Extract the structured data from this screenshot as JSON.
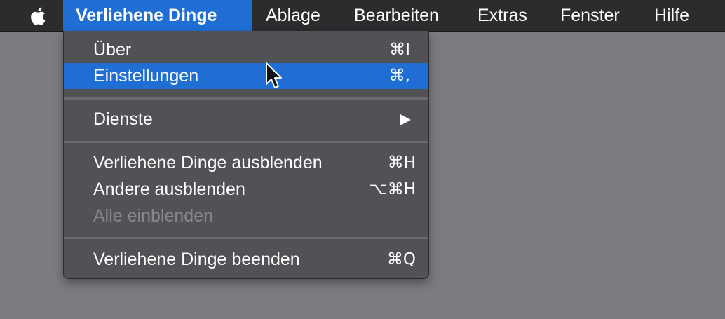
{
  "menubar": {
    "apple_icon": "apple-logo-icon",
    "items": [
      {
        "label": "Verliehene Dinge",
        "active": true
      },
      {
        "label": "Ablage"
      },
      {
        "label": "Bearbeiten"
      },
      {
        "label": "Extras"
      },
      {
        "label": "Fenster"
      },
      {
        "label": "Hilfe"
      }
    ]
  },
  "app_menu": {
    "items": [
      {
        "label": "Über",
        "shortcut": "⌘I"
      },
      {
        "label": "Einstellungen",
        "shortcut": "⌘,",
        "highlighted": true
      },
      {
        "label": "Dienste",
        "submenu_icon": "triangle-right-icon"
      },
      {
        "label": "Verliehene Dinge ausblenden",
        "shortcut": "⌘H"
      },
      {
        "label": "Andere ausblenden",
        "shortcut": "⌥⌘H"
      },
      {
        "label": "Alle einblenden",
        "disabled": true
      },
      {
        "label": "Verliehene Dinge beenden",
        "shortcut": "⌘Q"
      }
    ]
  },
  "colors": {
    "menubar_bg": "#2c2c2e",
    "accent": "#1f6ed4",
    "menu_bg": "#515256",
    "desktop_bg": "#7b7c80",
    "disabled_text": "#86878b"
  },
  "cursor_icon": "arrow-pointer-icon"
}
